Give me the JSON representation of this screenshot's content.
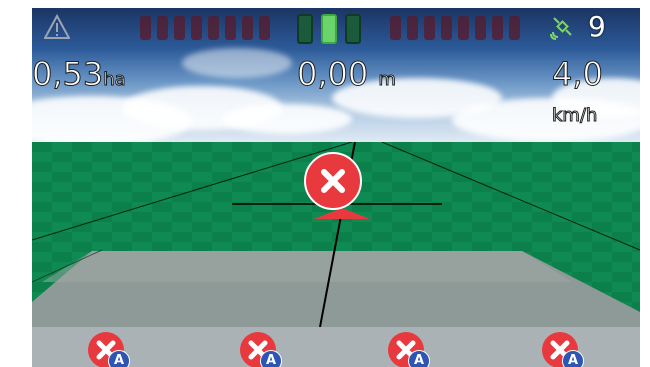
{
  "hud": {
    "area_value": "0,53",
    "area_unit": "ha",
    "offset_value": "0,00",
    "offset_unit": "m",
    "speed_value": "4,0",
    "speed_unit": "km/h",
    "satellite_count": "9"
  },
  "section_indicator": {
    "sections": [
      "off",
      "on",
      "off"
    ]
  },
  "bottom_buttons": [
    {
      "badge": "A"
    },
    {
      "badge": "A"
    },
    {
      "badge": "A"
    },
    {
      "badge": "A"
    }
  ],
  "colors": {
    "accent_red": "#e8393e",
    "field_green": "#0f8a52",
    "bar_gray": "#aab2b5",
    "badge_blue": "#2c55b4",
    "active_section": "#6bd36b"
  },
  "icons": [
    "warning-icon",
    "gps-satellite-icon",
    "close-icon"
  ]
}
